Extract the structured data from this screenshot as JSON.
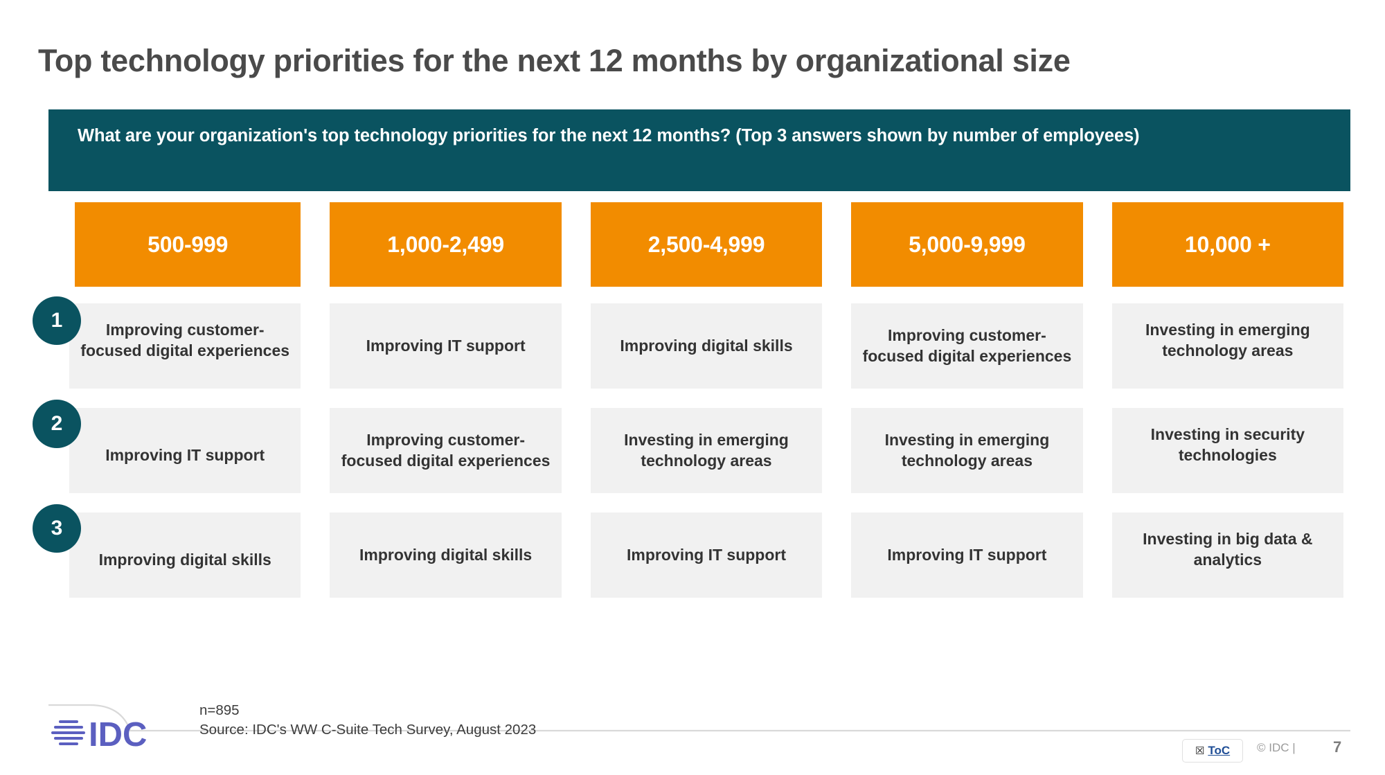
{
  "slide": {
    "title": "Top technology priorities for the next 12 months by organizational size",
    "question": "What are your organization's top technology priorities for the next 12 months? (Top 3 answers shown by number of employees)"
  },
  "colors": {
    "banner_teal": "#0a5360",
    "header_orange": "#f28c00",
    "cell_gray": "#f1f1f1",
    "badge_teal": "#0a5360",
    "title_gray": "#4a4a4a",
    "logo_purple": "#5b5fc0",
    "toc_blue": "#1f4e96"
  },
  "chart_data": {
    "type": "table",
    "title": "Top technology priorities for the next 12 months by organizational size",
    "subtitle": "What are your organization's top technology priorities for the next 12 months? (Top 3 answers shown by number of employees)",
    "columns": [
      "500-999",
      "1,000-2,499",
      "2,500-4,999",
      "5,000-9,999",
      "10,000 +"
    ],
    "row_labels": [
      "1",
      "2",
      "3"
    ],
    "rows": [
      [
        "Improving customer-focused digital experiences",
        "Improving IT support",
        "Improving digital skills",
        "Improving customer-focused digital experiences",
        "Investing in emerging technology areas"
      ],
      [
        "Improving IT support",
        "Improving customer-focused digital experiences",
        "Investing in emerging technology areas",
        "Investing in emerging technology areas",
        "Investing in security technologies"
      ],
      [
        "Improving digital skills",
        "Improving digital skills",
        "Improving IT support",
        "Improving IT support",
        "Investing in big data & analytics"
      ]
    ],
    "sample_size": "n=895",
    "source": "Source: IDC's WW C-Suite Tech Survey, August 2023"
  },
  "headers": {
    "c0": "500-999",
    "c1": "1,000-2,499",
    "c2": "2,500-4,999",
    "c3": "5,000-9,999",
    "c4": "10,000 +"
  },
  "ranks": {
    "r0": "1",
    "r1": "2",
    "r2": "3"
  },
  "cells": {
    "r0": {
      "c0": "Improving customer-focused digital experiences",
      "c1": "Improving IT support",
      "c2": "Improving digital skills",
      "c3": "Improving customer-focused digital experiences",
      "c4": "Investing in emerging technology areas"
    },
    "r1": {
      "c0": "Improving IT support",
      "c1": "Improving customer-focused digital experiences",
      "c2": "Investing in emerging technology areas",
      "c3": "Investing in emerging technology areas",
      "c4": "Investing in security technologies"
    },
    "r2": {
      "c0": "Improving digital skills",
      "c1": "Improving digital skills",
      "c2": "Improving IT support",
      "c3": "Improving IT support",
      "c4": "Investing in big data & analytics"
    }
  },
  "footer": {
    "sample_size": "n=895",
    "source": "Source: IDC's WW C-Suite Tech Survey, August 2023",
    "toc_glyph": "☒",
    "toc_label": "ToC",
    "copyright": "© IDC |",
    "page_number": "7",
    "logo_text": "IDC"
  }
}
